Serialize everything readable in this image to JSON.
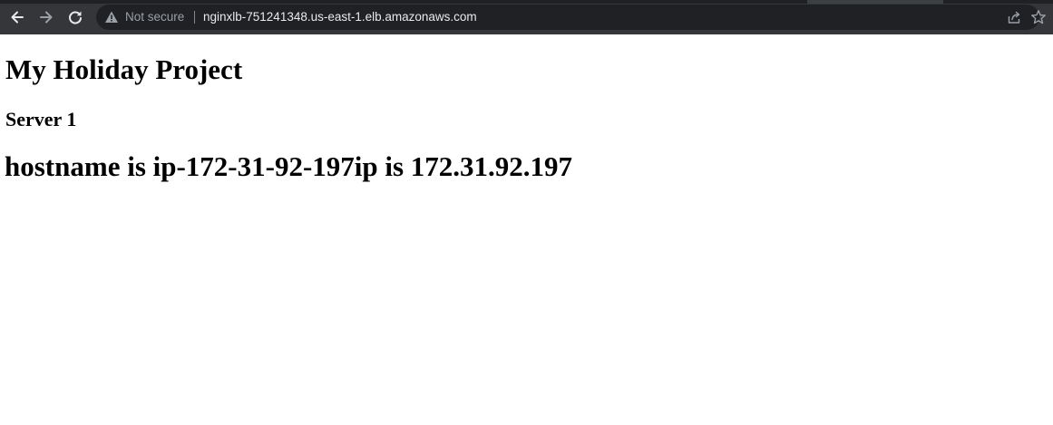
{
  "browser": {
    "security_label": "Not secure",
    "url": "nginxlb-751241348.us-east-1.elb.amazonaws.com",
    "icons": {
      "back": "back-arrow-icon",
      "forward": "forward-arrow-icon",
      "reload": "reload-icon",
      "security": "warning-triangle-icon",
      "share": "share-icon",
      "bookmark": "star-icon"
    },
    "colors": {
      "toolbar": "#35363a",
      "omnibox": "#202124",
      "url_text": "#e8eaed",
      "muted_text": "#9aa0a6"
    }
  },
  "page": {
    "title": "My Holiday Project",
    "server": "Server 1",
    "host_info": "hostname is ip-172-31-92-197ip is 172.31.92.197"
  }
}
